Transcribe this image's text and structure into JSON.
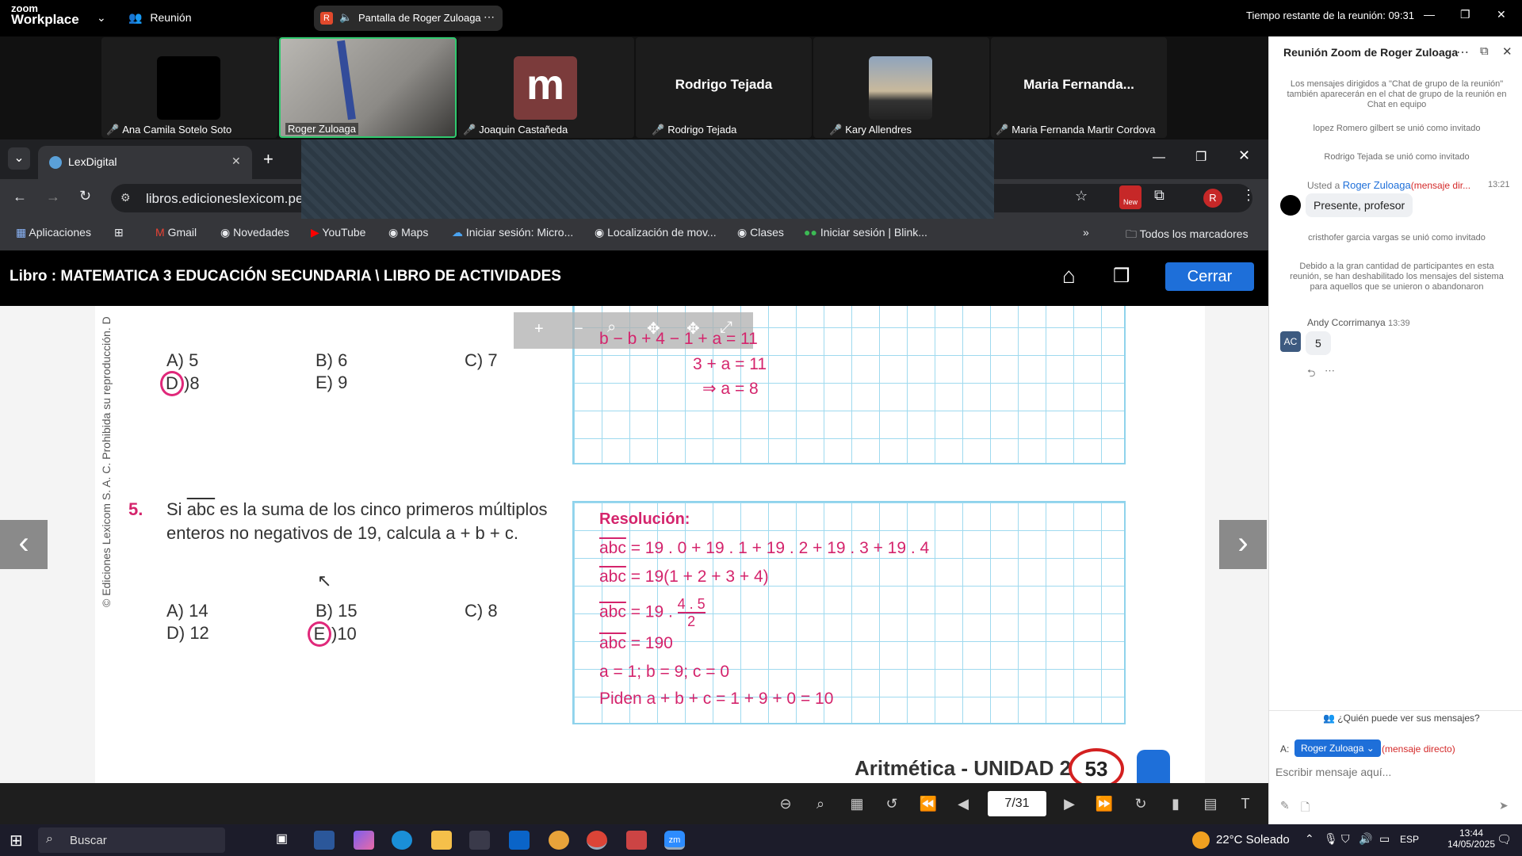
{
  "zoom": {
    "logo_top": "zoom",
    "logo_bottom": "Workplace",
    "meeting_menu": "Reunión",
    "share_label": "Pantalla de Roger Zuloaga",
    "share_badge": "R",
    "time_left": "Tiempo restante de la reunión: 09:31"
  },
  "participants": [
    {
      "name": "Ana Camila Sotelo Soto"
    },
    {
      "name": "Roger Zuloaga"
    },
    {
      "name": "Joaquin Castañeda",
      "avatar_letter": "m"
    },
    {
      "name": "Rodrigo Tejada",
      "big_name": "Rodrigo Tejada"
    },
    {
      "name": "Kary Allendres"
    },
    {
      "name": "Maria Fernanda Martir Cordova",
      "big_name": "Maria  Fernanda..."
    }
  ],
  "browser": {
    "tab_title": "LexDigital",
    "url": "libros.edicioneslexicom.pe/",
    "profile_letter": "R",
    "bookmarks": [
      "Aplicaciones",
      "Gmail",
      "Novedades",
      "YouTube",
      "Maps",
      "Iniciar sesión: Micro...",
      "Localización de mov...",
      "Clases",
      "Iniciar sesión | Blink..."
    ],
    "all_bookmarks": "Todos los marcadores",
    "new_badge": "New"
  },
  "book": {
    "title": "Libro : MATEMATICA 3 EDUCACIÓN SECUNDARIA \\ LIBRO DE ACTIVIDADES",
    "close_label": "Cerrar",
    "side_text": "© Ediciones Lexicom S. A. C. Prohibida su reproducción. D",
    "q4": {
      "a": "A) 5",
      "b": "B) 6",
      "c": "C) 7",
      "d_letter": "D",
      "d_val": ")8",
      "e": "E) 9",
      "work": [
        "b − b + 4 − 1 + a = 11",
        "3 + a = 11",
        "⇒ a = 8"
      ]
    },
    "q5": {
      "number": "5.",
      "text_pre": "Si ",
      "text_abc": "abc",
      "text_post": " es la suma de los cinco primeros múltiplos",
      "text_line2": "enteros no negativos de 19, calcula a + b + c.",
      "a": "A) 14",
      "b": "B) 15",
      "c": "C) 8",
      "d": "D) 12",
      "e_letter": "E",
      "e_val": ")10"
    },
    "resolution": {
      "heading": "Resolución:",
      "abc": "abc",
      "line1": " = 19 . 0 + 19 . 1 + 19 . 2 + 19 . 3 + 19 . 4",
      "line2": " = 19(1 + 2 + 3 + 4)",
      "line3": " = 19 . ",
      "frac_num": "4 . 5",
      "frac_den": "2",
      "line4": " = 190",
      "line5": "a = 1; b = 9; c = 0",
      "line6": "Piden a + b + c = 1 + 9 + 0 = 10"
    },
    "footer_unit": "Aritmética - UNIDAD 2",
    "footer_page": "53",
    "page_indicator": "7/31"
  },
  "chat": {
    "title": "Reunión Zoom de Roger Zuloaga",
    "notice": "Los mensajes dirigidos a \"Chat de grupo de la reunión\" también aparecerán en el chat de grupo de la reunión en Chat en equipo",
    "join1": "lopez Romero gilbert se unió como invitado",
    "join2": "Rodrigo Tejada se unió como invitado",
    "msg1_header_pre": "Usted a ",
    "msg1_to": "Roger Zuloaga",
    "msg1_tag": "(mensaje dir...",
    "msg1_time": "13:21",
    "msg1_text": "Presente, profesor",
    "join3": "cristhofer garcia vargas se unió como invitado",
    "system_notice": "Debido a la gran cantidad de participantes en esta reunión, se han deshabilitado los mensajes del sistema para aquellos que se unieron o abandonaron",
    "msg2_sender": "Andy Ccorrimanya",
    "msg2_time": "13:39",
    "msg2_initials": "AC",
    "msg2_text": "5",
    "who_can_see": "¿Quién puede ver sus mensajes?",
    "to_label": "A:",
    "to_value": "Roger Zuloaga",
    "direct_tag": "(mensaje directo)",
    "input_placeholder": "Escribir mensaje aquí..."
  },
  "taskbar": {
    "search": "Buscar",
    "weather": "22°C  Soleado",
    "lang": "ESP",
    "time": "13:44",
    "date": "14/05/2025"
  }
}
